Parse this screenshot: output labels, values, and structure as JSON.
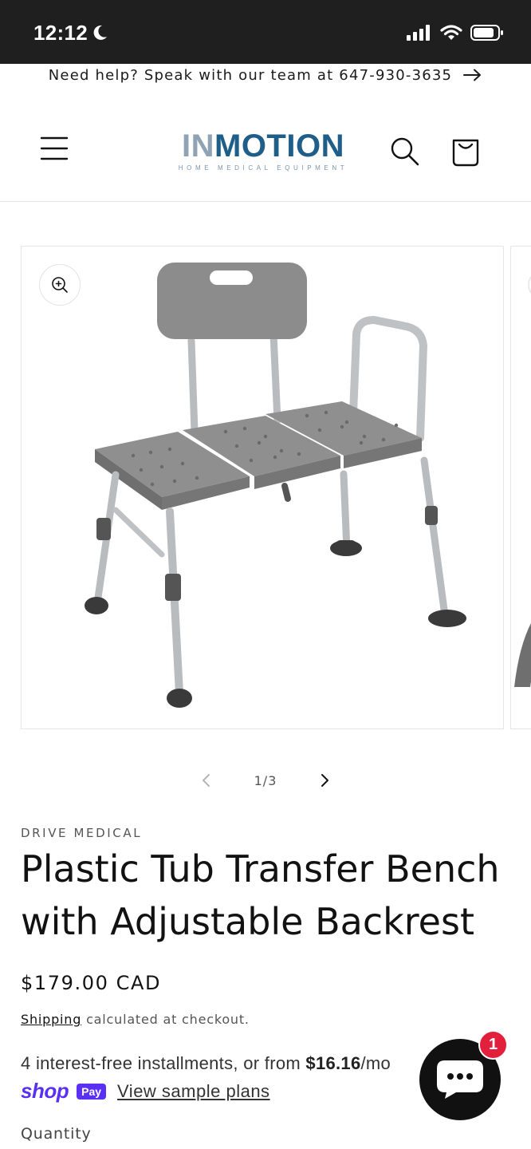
{
  "status_bar": {
    "time": "12:12"
  },
  "announcement": {
    "text": "Need help? Speak with our team at 647-930-3635"
  },
  "header": {
    "logo_in": "IN",
    "logo_motion": "MOTION",
    "logo_tagline": "HOME MEDICAL EQUIPMENT"
  },
  "gallery": {
    "counter": "1/3"
  },
  "product": {
    "vendor": "DRIVE MEDICAL",
    "title": "Plastic Tub Transfer Bench with Adjustable Backrest",
    "price": "$179.00 CAD",
    "shipping_link": "Shipping",
    "shipping_rest": " calculated at checkout.",
    "installments_prefix": "4 interest-free installments, or from ",
    "installments_amount": "$16.16",
    "installments_suffix": "/mo",
    "shop_word": "shop",
    "pay_badge": "Pay",
    "view_plans": "View sample plans",
    "quantity_label": "Quantity"
  },
  "chat": {
    "badge_count": "1"
  },
  "colors": {
    "accent_logo_dark": "#1f5e88",
    "accent_logo_light": "#8fa3b5",
    "shop_pay": "#5a31f4",
    "badge_red": "#e2203b"
  }
}
